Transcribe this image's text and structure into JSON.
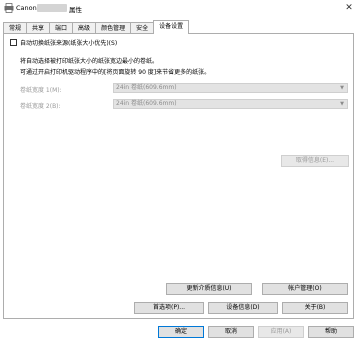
{
  "window": {
    "title_prefix": "Canon",
    "title_suffix": "属性",
    "close_label": "✕"
  },
  "tabs": [
    {
      "label": "常规"
    },
    {
      "label": "共享"
    },
    {
      "label": "端口"
    },
    {
      "label": "高级"
    },
    {
      "label": "颜色管理"
    },
    {
      "label": "安全"
    },
    {
      "label": "设备设置"
    }
  ],
  "auto_switch": {
    "label": "自动切换纸张来源(纸张大小优先)(S)",
    "checked": false
  },
  "description": {
    "line1": "将自动选择被打印纸张大小的纸张宽边最小的卷纸。",
    "line2": "可通过开启打印机驱动程序中的[将页面旋转 90 度]来节省更多的纸张。"
  },
  "roll_width_1": {
    "label": "卷纸宽度 1(M):",
    "value": "24in 卷纸(609.6mm)"
  },
  "roll_width_2": {
    "label": "卷纸宽度 2(B):",
    "value": "24in 卷纸(609.6mm)"
  },
  "buttons": {
    "get_info": "取得信息(E)...",
    "update_media": "更新介质信息(U)",
    "account_mgmt": "帐户管理(O)",
    "preferences": "首选项(P)...",
    "device_info": "设备信息(D)",
    "about": "关于(B)",
    "ok": "确定",
    "cancel": "取消",
    "apply": "应用(A)",
    "help": "帮助"
  }
}
